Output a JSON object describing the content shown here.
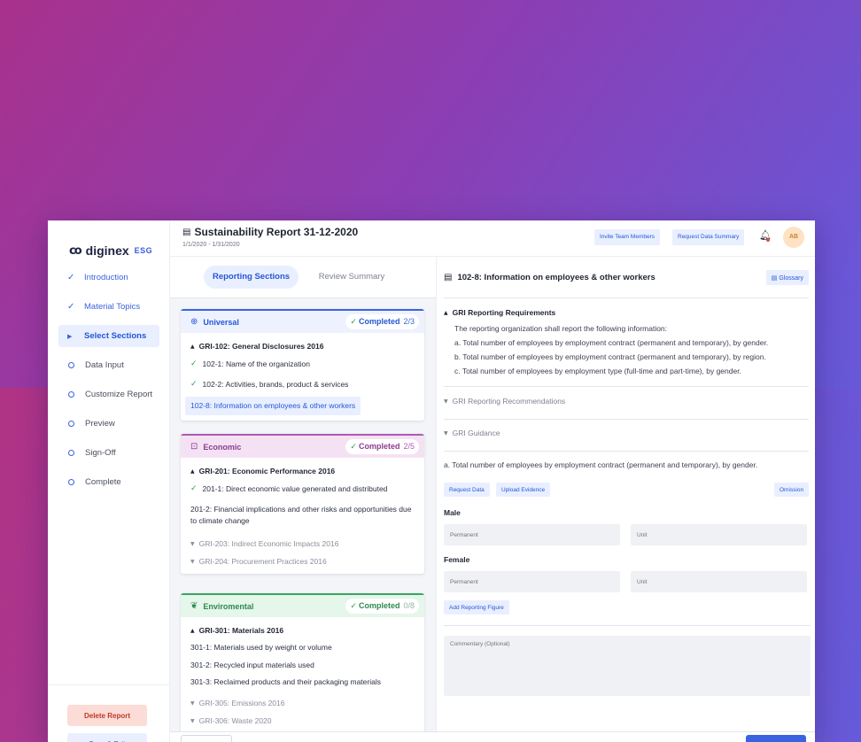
{
  "brand": {
    "logo_mark": "co",
    "name": "diginex",
    "suffix": "ESG"
  },
  "nav": {
    "steps": [
      {
        "label": "Introduction",
        "state": "done"
      },
      {
        "label": "Material Topics",
        "state": "done"
      },
      {
        "label": "Select Sections",
        "state": "active"
      },
      {
        "label": "Data Input",
        "state": "pending"
      },
      {
        "label": "Customize Report",
        "state": "pending"
      },
      {
        "label": "Preview",
        "state": "pending"
      },
      {
        "label": "Sign-Off",
        "state": "pending"
      },
      {
        "label": "Complete",
        "state": "pending"
      }
    ],
    "delete_label": "Delete Report",
    "save_label": "Save & Exit"
  },
  "header": {
    "title": "Sustainability Report 31-12-2020",
    "date_range": "1/1/2020 - 1/31/2020",
    "invite_label": "Invite Team Members",
    "request_summary_label": "Request Data Summary",
    "avatar_initials": "AB"
  },
  "middle": {
    "tabs": {
      "reporting": "Reporting Sections",
      "review": "Review Summary"
    },
    "universal": {
      "title": "Universal",
      "completed_label": "Completed",
      "completed_count": "2/3",
      "group": "GRI-102: General Disclosures 2016",
      "items": [
        "102-1: Name of the organization",
        "102-2: Activities, brands, product & services"
      ],
      "selected_item": "102-8: Information on employees & other workers"
    },
    "economic": {
      "title": "Economic",
      "completed_label": "Completed",
      "completed_count": "2/5",
      "group": "GRI-201: Economic Performance 2016",
      "item_done": "201-1: Direct economic value generated and distributed",
      "item_plain": "201-2: Financial implications and other risks and opportunities due to climate change",
      "collapsed": [
        "GRI-203: Indirect Economic Impacts 2016",
        "GRI-204: Procurement Practices 2016"
      ]
    },
    "environmental": {
      "title": "Enviromental",
      "completed_label": "Completed",
      "completed_count": "0/8",
      "group": "GRI-301: Materials 2016",
      "items": [
        "301-1: Materials used by weight or volume",
        "301-2: Recycled input materials used",
        "301-3: Reclaimed products and their packaging materials"
      ],
      "collapsed": [
        "GRI-305: Emissions 2016",
        "GRI-306: Waste 2020"
      ]
    }
  },
  "detail": {
    "title": "102-8: Information on employees & other workers",
    "glossary_label": "Glossary",
    "requirements": {
      "title": "GRI Reporting Requirements",
      "intro": "The reporting organization shall report the following information:",
      "lines": [
        "a. Total number of employees by employment contract (permanent and temporary), by gender.",
        "b. Total number of employees by employment contract (permanent and temporary), by region.",
        "c. Total number of employees by employment type (full-time and part-time), by gender."
      ]
    },
    "recommendations_title": "GRI Reporting Recommendations",
    "guidance_title": "GRI Guidance",
    "question": "a. Total number of employees by employment contract (permanent and temporary), by gender.",
    "request_data_label": "Request Data",
    "upload_label": "Upload Evidence",
    "omission_label": "Omission",
    "male_label": "Male",
    "female_label": "Female",
    "permanent_placeholder": "Permanent",
    "unit_placeholder": "Unit",
    "add_figure_label": "Add Reporting Figure",
    "commentary_placeholder": "Commentary (Optional)"
  },
  "colors": {
    "accent": "#3a63e0",
    "success": "#2e9b5a",
    "danger": "#c0392b"
  }
}
